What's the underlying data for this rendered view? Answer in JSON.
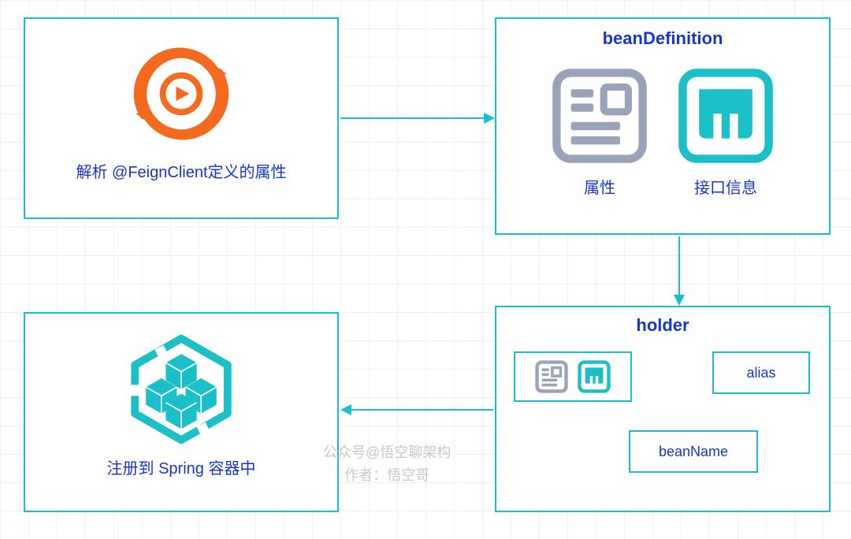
{
  "box1": {
    "caption": "解析 @FeignClient定义的属性"
  },
  "box2": {
    "title": "beanDefinition",
    "attr_label": "属性",
    "iface_label": "接口信息"
  },
  "box3": {
    "caption": "注册到 Spring 容器中"
  },
  "box4": {
    "title": "holder",
    "alias": "alias",
    "beanName": "beanName"
  },
  "watermark": {
    "line1": "公众号@悟空聊架构",
    "line2": "作者：悟空哥"
  }
}
